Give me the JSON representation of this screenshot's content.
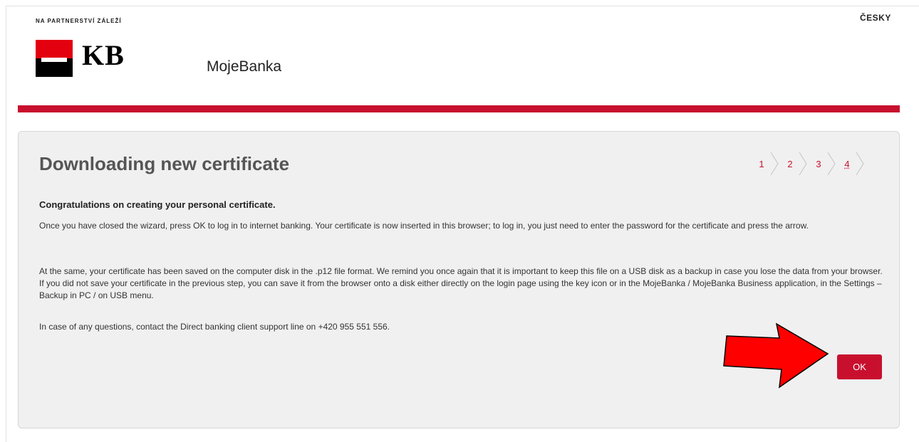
{
  "header": {
    "tagline": "NA PARTNERSTVÍ ZÁLEŽÍ",
    "language_label": "ČESKY",
    "logo_text": "KB",
    "app_name": "MojeBanka"
  },
  "colors": {
    "brand_red": "#c8102e",
    "logo_red": "#e3000f",
    "panel_bg": "#f0f0f0",
    "annotation_arrow": "#ff0000"
  },
  "wizard": {
    "title": "Downloading new certificate",
    "steps": [
      {
        "label": "1",
        "active": false
      },
      {
        "label": "2",
        "active": false
      },
      {
        "label": "3",
        "active": false
      },
      {
        "label": "4",
        "active": true
      }
    ],
    "lead": "Congratulations on creating your personal certificate.",
    "paragraphs": [
      "Once you have closed the wizard, press OK to log in to internet banking. Your certificate is now inserted in this browser; to log in, you just need to enter the password for the certificate and press the arrow.",
      "At the same, your certificate has been saved on the computer disk in the .p12 file format. We remind you once again that it is important to keep this file on a USB disk as a backup in case you lose the data from your browser. If you did not save your certificate in the previous step, you can save it from the browser onto a disk either directly on the login page using the key icon or in the MojeBanka / MojeBanka Business application, in the Settings – Backup in PC / on USB menu.",
      "In case of any questions, contact the Direct banking client support line on +420 955 551 556."
    ],
    "ok_label": "OK"
  },
  "icons": {
    "logo": "kb-logo-icon",
    "step_separator": "chevron-right-icon",
    "annotation": "red-arrow-icon"
  }
}
